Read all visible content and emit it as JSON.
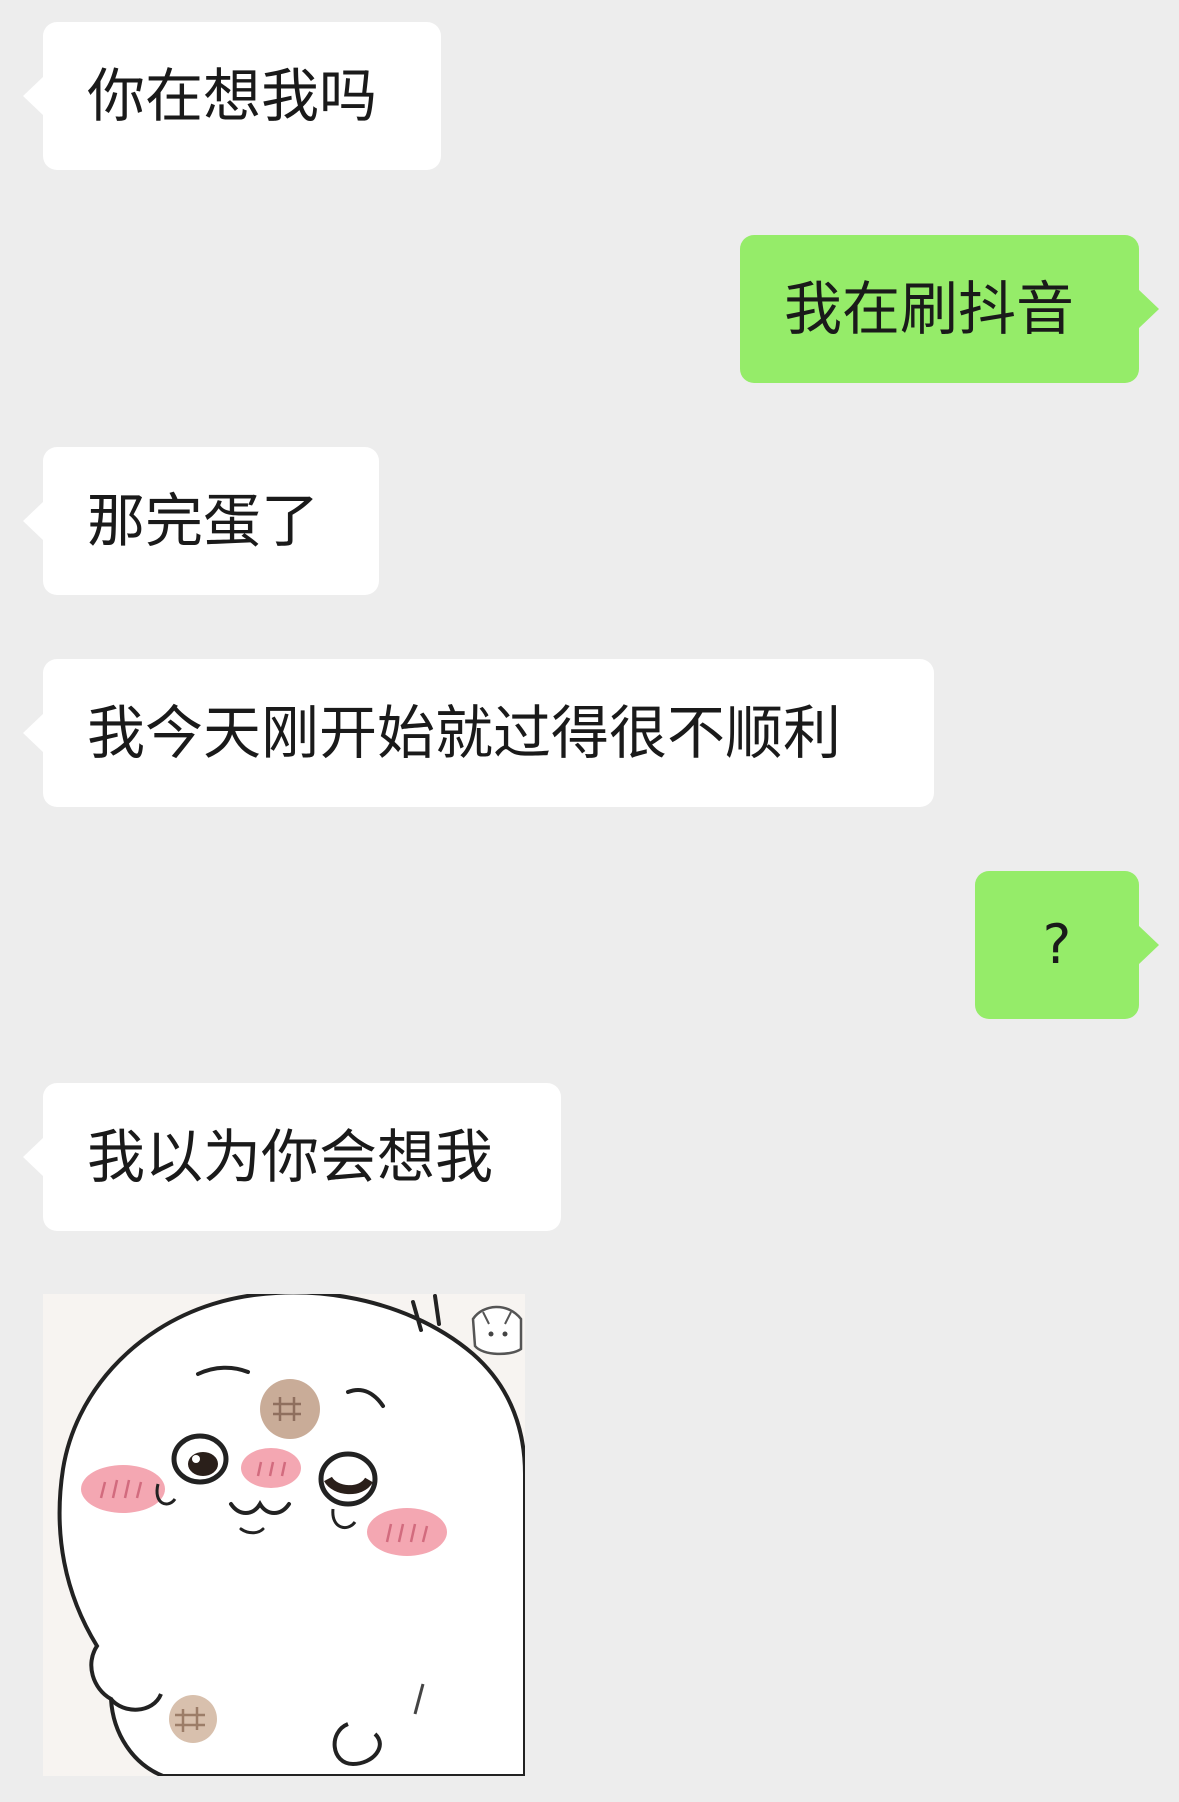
{
  "messages": [
    {
      "id": "m1",
      "sender": "other",
      "text": "你在想我吗"
    },
    {
      "id": "m2",
      "sender": "self",
      "text": "我在刷抖音"
    },
    {
      "id": "m3",
      "sender": "other",
      "text": "那完蛋了"
    },
    {
      "id": "m4",
      "sender": "other",
      "text": "我今天刚开始就过得很不顺利"
    },
    {
      "id": "m5",
      "sender": "self",
      "text": "?"
    },
    {
      "id": "m6",
      "sender": "other",
      "text": "我以为你会想我"
    },
    {
      "id": "m7",
      "sender": "other",
      "type": "sticker",
      "sticker_name": "chiikawa-seal-blushing-face"
    }
  ],
  "colors": {
    "chat_background": "#ededed",
    "incoming_bubble": "#ffffff",
    "outgoing_bubble": "#95ec69",
    "message_text": "#1a1a1a"
  }
}
